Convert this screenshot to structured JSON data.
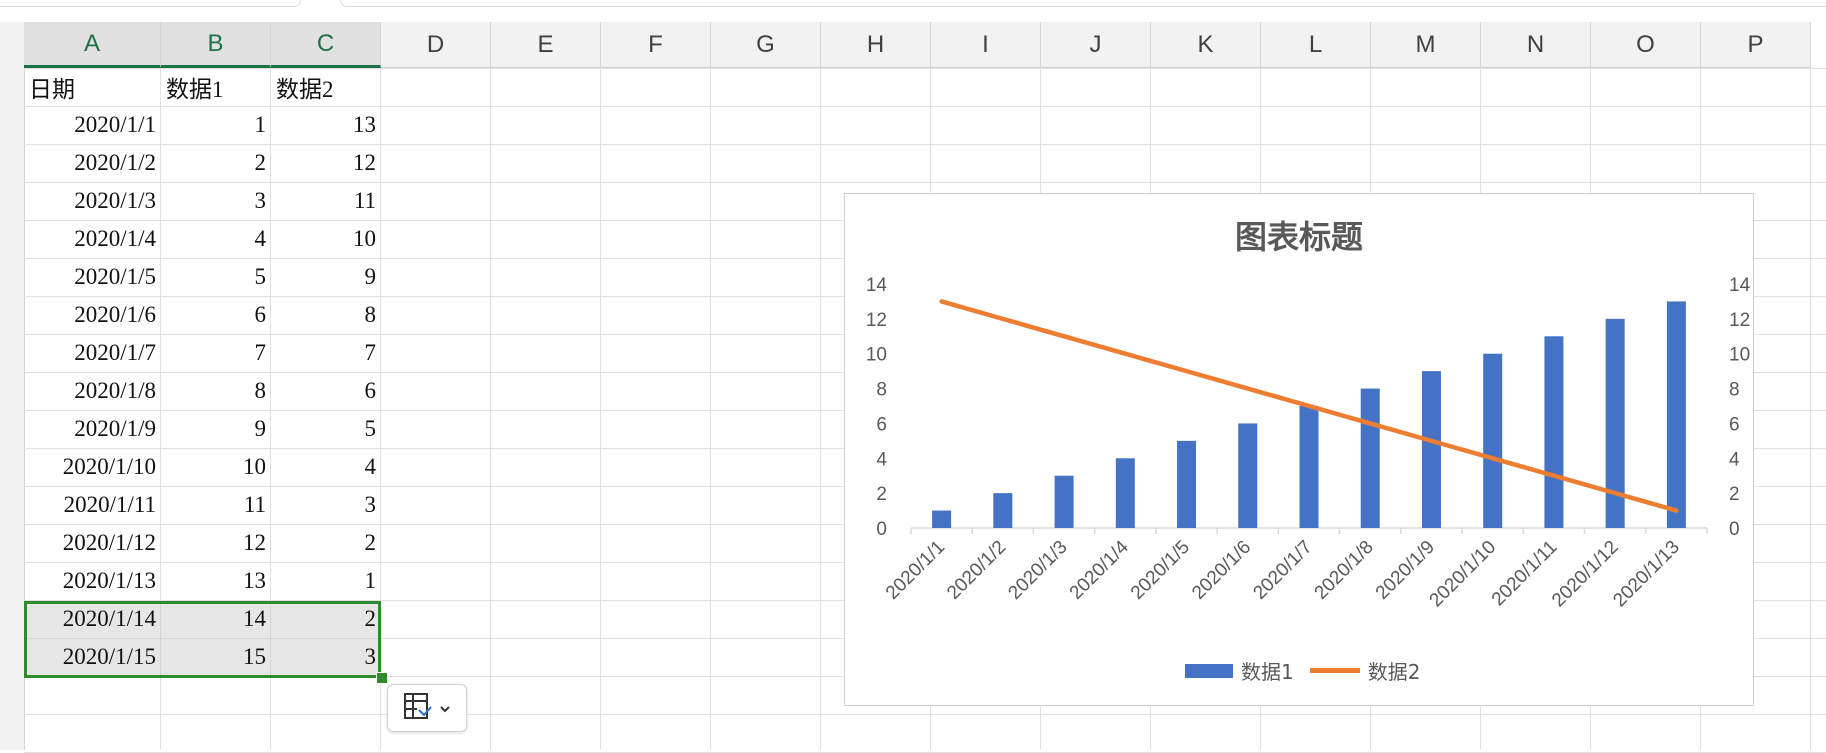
{
  "columns": [
    "A",
    "B",
    "C",
    "D",
    "E",
    "F",
    "G",
    "H",
    "I",
    "J",
    "K",
    "L",
    "M",
    "N",
    "O",
    "P"
  ],
  "selected_columns": [
    "A",
    "B",
    "C"
  ],
  "table": {
    "headers": [
      "日期",
      "数据1",
      "数据2"
    ],
    "rows": [
      [
        "2020/1/1",
        "1",
        "13"
      ],
      [
        "2020/1/2",
        "2",
        "12"
      ],
      [
        "2020/1/3",
        "3",
        "11"
      ],
      [
        "2020/1/4",
        "4",
        "10"
      ],
      [
        "2020/1/5",
        "5",
        "9"
      ],
      [
        "2020/1/6",
        "6",
        "8"
      ],
      [
        "2020/1/7",
        "7",
        "7"
      ],
      [
        "2020/1/8",
        "8",
        "6"
      ],
      [
        "2020/1/9",
        "9",
        "5"
      ],
      [
        "2020/1/10",
        "10",
        "4"
      ],
      [
        "2020/1/11",
        "11",
        "3"
      ],
      [
        "2020/1/12",
        "12",
        "2"
      ],
      [
        "2020/1/13",
        "13",
        "1"
      ],
      [
        "2020/1/14",
        "14",
        "2"
      ],
      [
        "2020/1/15",
        "15",
        "3"
      ]
    ]
  },
  "quick_button": {
    "icon": "table-format-icon",
    "caret": "chevron-down-icon"
  },
  "chart_data": {
    "type": "bar",
    "title": "图表标题",
    "categories": [
      "2020/1/1",
      "2020/1/2",
      "2020/1/3",
      "2020/1/4",
      "2020/1/5",
      "2020/1/6",
      "2020/1/7",
      "2020/1/8",
      "2020/1/9",
      "2020/1/10",
      "2020/1/11",
      "2020/1/12",
      "2020/1/13"
    ],
    "series": [
      {
        "name": "数据1",
        "type": "bar",
        "color": "#4472c4",
        "values": [
          1,
          2,
          3,
          4,
          5,
          6,
          7,
          8,
          9,
          10,
          11,
          12,
          13
        ]
      },
      {
        "name": "数据2",
        "type": "line",
        "color": "#ed7d31",
        "values": [
          13,
          12,
          11,
          10,
          9,
          8,
          7,
          6,
          5,
          4,
          3,
          2,
          1
        ]
      }
    ],
    "ylim": [
      0,
      14
    ],
    "y_ticks": [
      0,
      2,
      4,
      6,
      8,
      10,
      12,
      14
    ],
    "y2_ticks": [
      0,
      2,
      4,
      6,
      8,
      10,
      12,
      14
    ],
    "legend": "bottom",
    "grid": false
  }
}
